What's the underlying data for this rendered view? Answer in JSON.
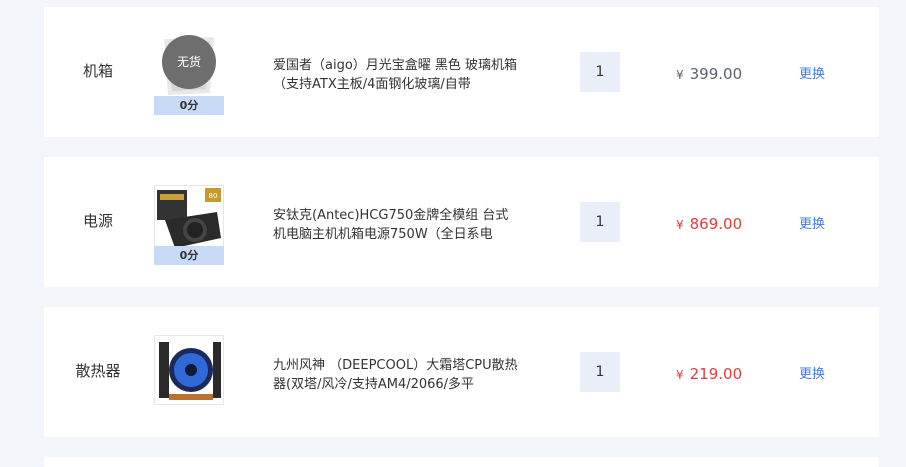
{
  "currency_symbol": "¥",
  "colors": {
    "price_grey": "#5d6270",
    "price_red": "#e23b3b",
    "link": "#3d7de3",
    "badge_bg": "#c8dbf6",
    "qty_bg": "#e9eef8"
  },
  "items": [
    {
      "category": "机箱",
      "stock_label": "无货",
      "rating": "0分",
      "name": "爱国者（aigo）月光宝盒曜 黑色 玻璃机箱（支持ATX主板/4面钢化玻璃/自带",
      "quantity": "1",
      "price": "399.00",
      "action": "更换",
      "image_icon": "pc-case-icon"
    },
    {
      "category": "电源",
      "rating": "0分",
      "name": "安钛克(Antec)HCG750金牌全模组 台式机电脑主机机箱电源750W（全日系电",
      "quantity": "1",
      "price": "869.00",
      "action": "更换",
      "image_icon": "power-supply-icon"
    },
    {
      "category": "散热器",
      "name": "九州风神 （DEEPCOOL）大霜塔CPU散热器(双塔/风冷/支持AM4/2066/多平",
      "quantity": "1",
      "price": "219.00",
      "action": "更换",
      "image_icon": "cpu-cooler-icon"
    }
  ]
}
